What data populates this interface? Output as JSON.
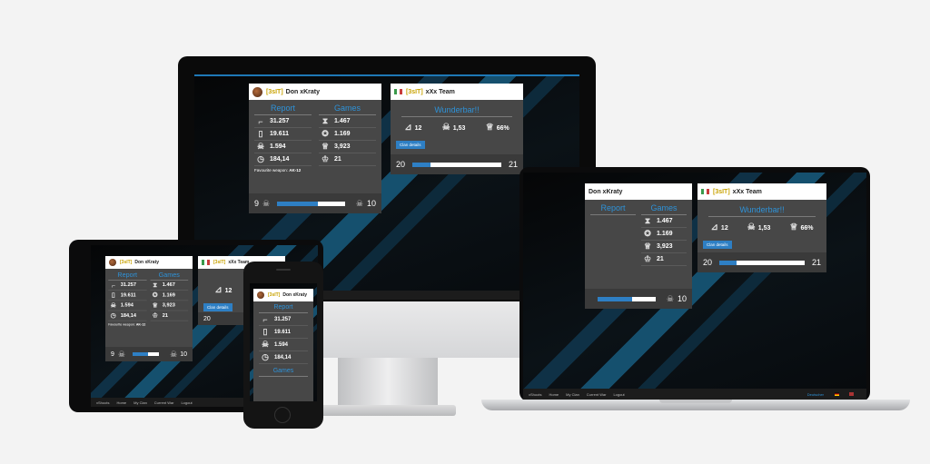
{
  "player": {
    "tag": "[3sIT]",
    "name": "Don xKraty",
    "report_title": "Report",
    "games_title": "Games",
    "report_stats": [
      "31.257",
      "19.611",
      "1.594",
      "184,14"
    ],
    "games_stats": [
      "1.467",
      "1.169",
      "3,923",
      "21"
    ],
    "fav_weapon_label": "Favourite weapon:",
    "fav_weapon": "AK-12",
    "foot_left": "9",
    "foot_right": "10",
    "bar_fraction": 0.6
  },
  "clan": {
    "tag": "[3sIT]",
    "name": "xXx Team",
    "title": "Wunderbar!!",
    "stat_1": "12",
    "stat_2": "1,53",
    "stat_3": "66%",
    "button": "Clan details",
    "foot_left": "20",
    "foot_right": "21",
    "bar_fraction": 0.2
  },
  "nav": {
    "brand": "xShoots",
    "items": [
      "Home",
      "My Clan",
      "Current War",
      "Logout"
    ],
    "lang_label": "Deutscher"
  },
  "icons": {
    "gun": "gun-icon",
    "grave": "grave-icon",
    "skull": "skull-icon",
    "clock": "clock-icon",
    "hourglass": "hourglass-icon",
    "medal": "medal-icon",
    "trophy": "trophy-icon",
    "crown": "crown-icon",
    "boot": "boot-icon",
    "apple": "apple-logo"
  }
}
